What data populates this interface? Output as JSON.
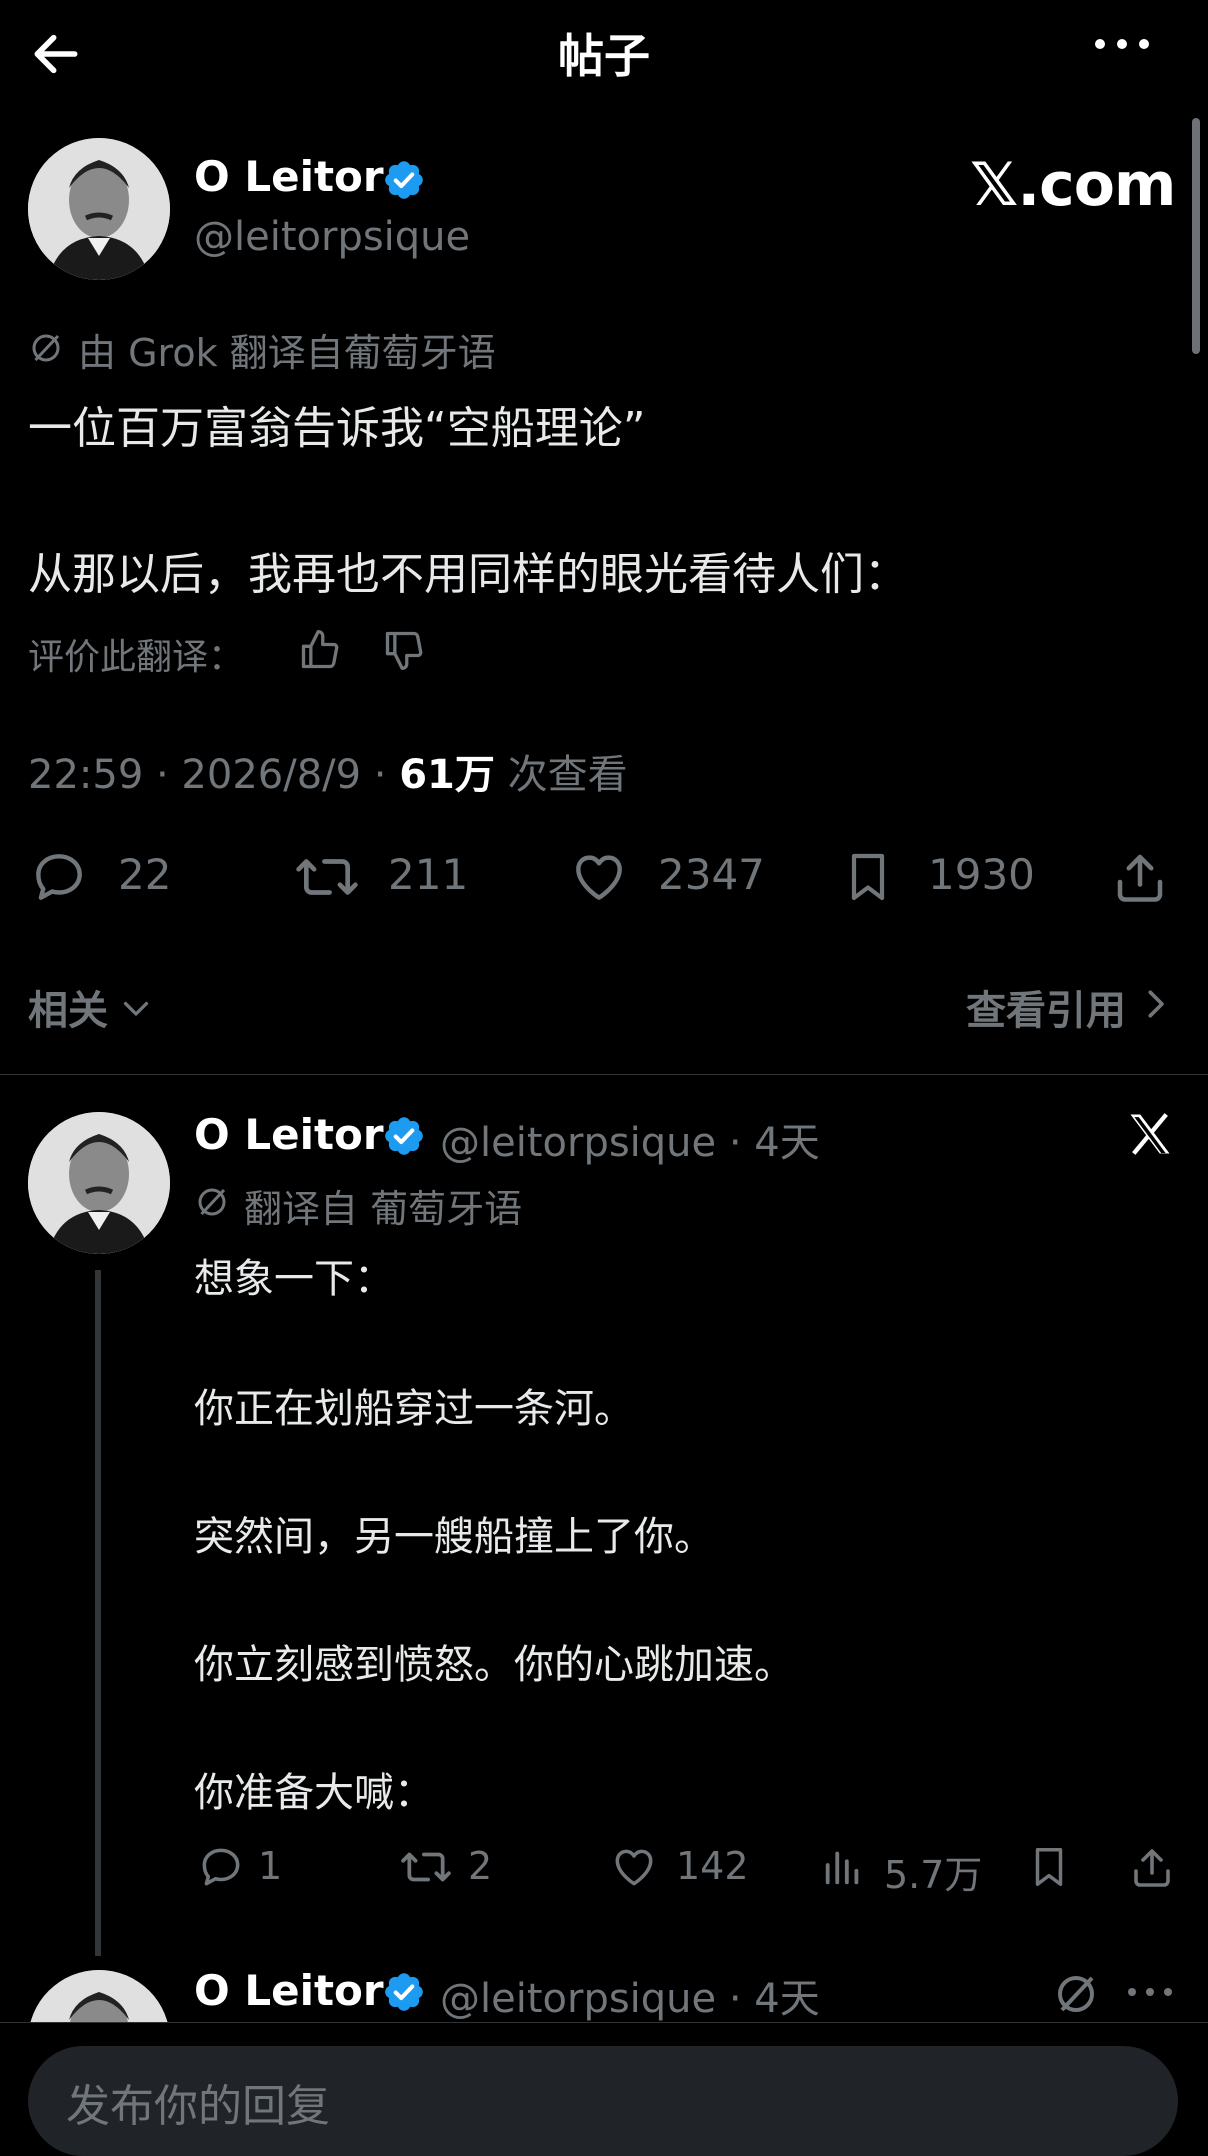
{
  "header": {
    "title": "帖子"
  },
  "main_post": {
    "name": "O Leitor",
    "handle": "@leitorpsique",
    "watermark": "𝕏.com",
    "translate_note": "由 Grok 翻译自葡萄牙语",
    "text_line1": "一位百万富翁告诉我“空船理论”",
    "text_line2": "从那以后，我再也不用同样的眼光看待人们：",
    "rate_label": "评价此翻译：",
    "timestamp": "22:59 · 2026/8/9 · ",
    "views_count": "61万",
    "views_label": " 次查看",
    "stats": {
      "replies": "22",
      "reposts": "211",
      "likes": "2347",
      "bookmarks": "1930"
    },
    "related_label": "相关",
    "quotes_label": "查看引用"
  },
  "reply1": {
    "name": "O Leitor",
    "handle_time": "@leitorpsique · 4天",
    "translate_note": "翻译自 葡萄牙语",
    "lines": [
      "想象一下：",
      "你正在划船穿过一条河。",
      "突然间，另一艘船撞上了你。",
      "你立刻感到愤怒。你的心跳加速。",
      "你准备大喊："
    ],
    "stats": {
      "replies": "1",
      "reposts": "2",
      "likes": "142",
      "views": "5.7万"
    }
  },
  "reply2": {
    "name": "O Leitor",
    "handle_time": "@leitorpsique · 4天"
  },
  "composer": {
    "placeholder": "发布你的回复"
  },
  "icons": {
    "back": "arrow-left-icon",
    "more": "more-horizontal-icon",
    "verified": "verified-badge-icon",
    "translate": "translate-icon",
    "thumbs_up": "thumbs-up-icon",
    "thumbs_down": "thumbs-down-icon",
    "reply": "reply-icon",
    "repost": "repost-icon",
    "like": "heart-icon",
    "bookmark": "bookmark-icon",
    "share": "share-icon",
    "views": "views-icon",
    "x_logo": "x-logo-icon",
    "chevron_down": "chevron-down-icon",
    "chevron_right": "chevron-right-icon"
  },
  "colors": {
    "background": "#000000",
    "verified": "#1d9bf0",
    "muted": "#71767b"
  }
}
